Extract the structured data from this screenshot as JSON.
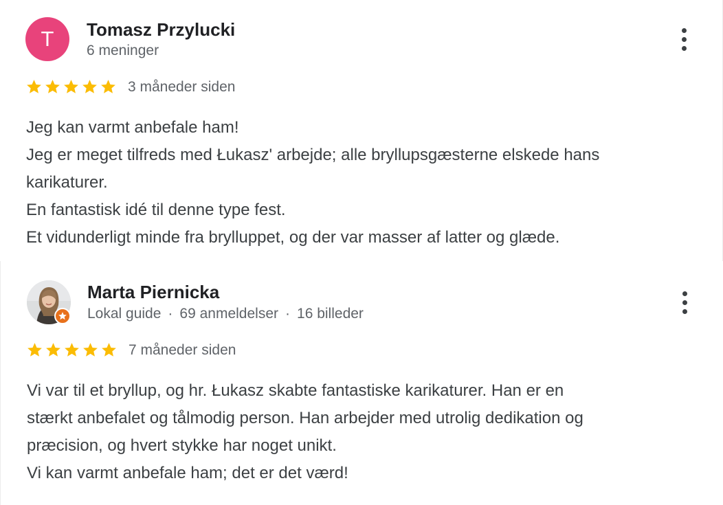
{
  "colors": {
    "avatar_bg": "#e8437b",
    "star": "#fbbc04",
    "guide_badge": "#e8711c"
  },
  "reviews": [
    {
      "author": "Tomasz Przylucki",
      "avatar_letter": "T",
      "meta": "6 meninger",
      "rating": 5,
      "time": "3 måneder siden",
      "text_lines": [
        "Jeg kan varmt anbefale ham!",
        "Jeg er meget tilfreds med Łukasz' arbejde; alle bryllupsgæsterne elskede hans",
        "karikaturer.",
        "En fantastisk idé til denne type fest.",
        "Et vidunderligt minde fra brylluppet, og der var masser af latter og glæde."
      ]
    },
    {
      "author": "Marta Piernicka",
      "meta_parts": [
        "Lokal guide",
        "69 anmeldelser",
        "16 billeder"
      ],
      "meta_separator": "·",
      "rating": 5,
      "time": "7 måneder siden",
      "text_lines": [
        "Vi var til et bryllup, og hr. Łukasz skabte fantastiske karikaturer. Han er en",
        "stærkt anbefalet og tålmodig person. Han arbejder med utrolig dedikation og",
        "præcision, og hvert stykke har noget unikt.",
        "Vi kan varmt anbefale ham; det er det værd!"
      ]
    }
  ],
  "icons": {
    "menu": "more-vert-icon",
    "star": "star-icon",
    "guide": "local-guide-badge-icon"
  }
}
